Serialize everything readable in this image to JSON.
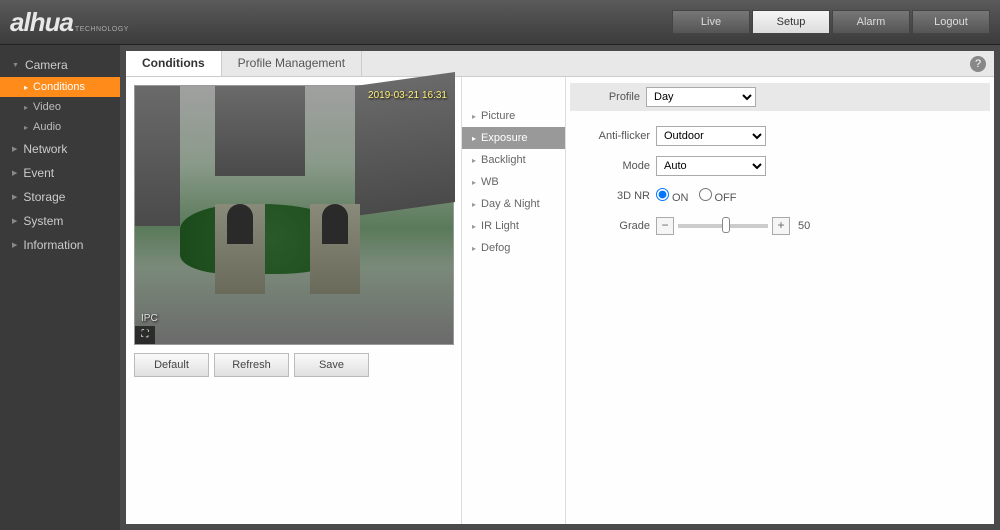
{
  "logo": {
    "text": "alhua",
    "sub": "TECHNOLOGY"
  },
  "top_nav": {
    "live": "Live",
    "setup": "Setup",
    "alarm": "Alarm",
    "logout": "Logout"
  },
  "sidebar": {
    "camera": "Camera",
    "conditions": "Conditions",
    "video": "Video",
    "audio": "Audio",
    "network": "Network",
    "event": "Event",
    "storage": "Storage",
    "system": "System",
    "information": "Information"
  },
  "tabs": {
    "conditions": "Conditions",
    "profile_mgmt": "Profile Management"
  },
  "preview": {
    "timestamp": "2019-03-21 16:31",
    "label": "IPC",
    "fullscreen": "⛶"
  },
  "buttons": {
    "default": "Default",
    "refresh": "Refresh",
    "save": "Save"
  },
  "categories": {
    "picture": "Picture",
    "exposure": "Exposure",
    "backlight": "Backlight",
    "wb": "WB",
    "day_night": "Day & Night",
    "ir_light": "IR Light",
    "defog": "Defog"
  },
  "form": {
    "profile_label": "Profile",
    "profile_value": "Day",
    "antiflicker_label": "Anti-flicker",
    "antiflicker_value": "Outdoor",
    "mode_label": "Mode",
    "mode_value": "Auto",
    "nr_label": "3D NR",
    "on": "ON",
    "off": "OFF",
    "grade_label": "Grade",
    "grade_value": "50",
    "minus": "−",
    "plus": "+"
  },
  "help": "?"
}
